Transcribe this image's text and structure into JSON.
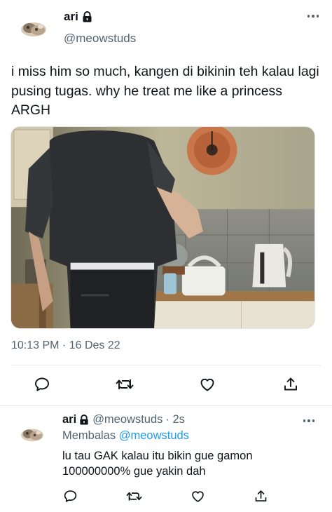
{
  "tweet": {
    "display_name": "ari",
    "handle": "@meowstuds",
    "text": "i miss him so much, kangen di bikinin teh kalau lagi pusing tugas. why he treat me like a princess ARGH",
    "timestamp": "10:13 PM · 16 Des 22",
    "photo_alt": "Person making tea in a kitchen"
  },
  "reply": {
    "display_name": "ari",
    "handle": "@meowstuds",
    "time": "· 2s",
    "replying_prefix": "Membalas",
    "replying_to": "@meowstuds",
    "text": "lu tau GAK kalau itu bikin gue gamon 100000000% gue yakin dah"
  },
  "icons": {
    "lock": "lock-icon",
    "more": "more-horizontal-icon",
    "reply": "comment-icon",
    "retweet": "retweet-icon",
    "like": "heart-icon",
    "share": "share-icon"
  },
  "colors": {
    "text": "#0f1419",
    "secondary": "#536471",
    "link": "#1d9bf0",
    "divider": "#e7e9ea"
  }
}
